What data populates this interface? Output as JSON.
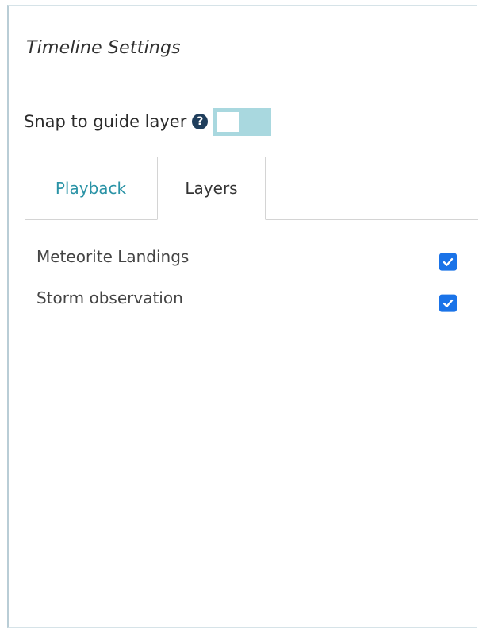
{
  "panel": {
    "title": "Timeline Settings"
  },
  "snap": {
    "label": "Snap to guide layer",
    "help_glyph": "?",
    "toggle_on": false
  },
  "tabs": [
    {
      "label": "Playback",
      "active": false
    },
    {
      "label": "Layers",
      "active": true
    }
  ],
  "layers": [
    {
      "label": "Meteorite Landings",
      "checked": true
    },
    {
      "label": "Storm observation",
      "checked": true
    }
  ],
  "colors": {
    "accent": "#2a93a6",
    "toggle_bg": "#a9d8df",
    "checkbox": "#1a73e8",
    "help_icon": "#1f3e5c"
  },
  "icons": {
    "help": "question-circle-icon",
    "check": "checkmark-icon"
  }
}
